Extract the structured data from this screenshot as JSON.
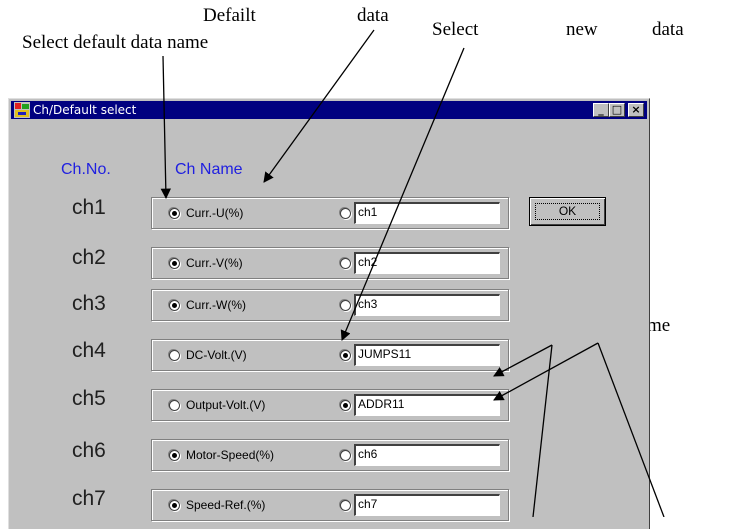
{
  "annotations": {
    "defailt": "Defailt",
    "data": "data",
    "select_default_name": "Select default data name",
    "select_new_data_1": "Select",
    "select_new_data_2": "new",
    "select_new_data_3": "data",
    "new_data_name": "New data name"
  },
  "window": {
    "title": "Ch/Default select",
    "minimize": "_",
    "maximize": "□",
    "close": "×"
  },
  "headers": {
    "ch_no": "Ch.No.",
    "ch_name": "Ch Name"
  },
  "ok_label": "OK",
  "channels": [
    {
      "label": "ch1",
      "default_name": "Curr.-U(%)",
      "new_name": "ch1",
      "selected": "default"
    },
    {
      "label": "ch2",
      "default_name": "Curr.-V(%)",
      "new_name": "ch2",
      "selected": "default"
    },
    {
      "label": "ch3",
      "default_name": "Curr.-W(%)",
      "new_name": "ch3",
      "selected": "default"
    },
    {
      "label": "ch4",
      "default_name": "DC-Volt.(V)",
      "new_name": "JUMPS11",
      "selected": "new"
    },
    {
      "label": "ch5",
      "default_name": "Output-Volt.(V)",
      "new_name": "ADDR11",
      "selected": "new"
    },
    {
      "label": "ch6",
      "default_name": "Motor-Speed(%)",
      "new_name": "ch6",
      "selected": "default"
    },
    {
      "label": "ch7",
      "default_name": "Speed-Ref.(%)",
      "new_name": "ch7",
      "selected": "default"
    }
  ]
}
